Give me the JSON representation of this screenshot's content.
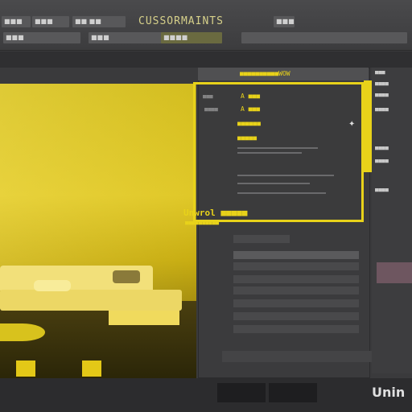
{
  "app": {
    "brand_text": "Unin",
    "brand_accent": "#e8d21a"
  },
  "topbar": {
    "menu_items": [
      "■■■",
      "■■■",
      "■■ ■■",
      "■■■■",
      "■■■■"
    ],
    "title": "CUSSORMAINTS",
    "sub_items": [
      "■■■",
      "■■■"
    ]
  },
  "panel": {
    "header_label": "■■■■",
    "highlight_title": "■■■■■■■■■■WOW",
    "row_a": "A  ■■■",
    "row_b": "A  ■■■",
    "row_c": "■■■■■■",
    "row_d": "■■■■■",
    "side_label_1": "■■■",
    "side_label_2": "■■■■"
  },
  "callout": {
    "title": "Unwrol ■■■■■",
    "subtitle": "■■■■■■■■■■"
  },
  "right_panel": {
    "items": [
      "■■■",
      "■■■■",
      "■■■■",
      "■■■■",
      "■■■■",
      "■■■■",
      "■■■■"
    ]
  },
  "icons": {
    "star": "star-icon"
  }
}
